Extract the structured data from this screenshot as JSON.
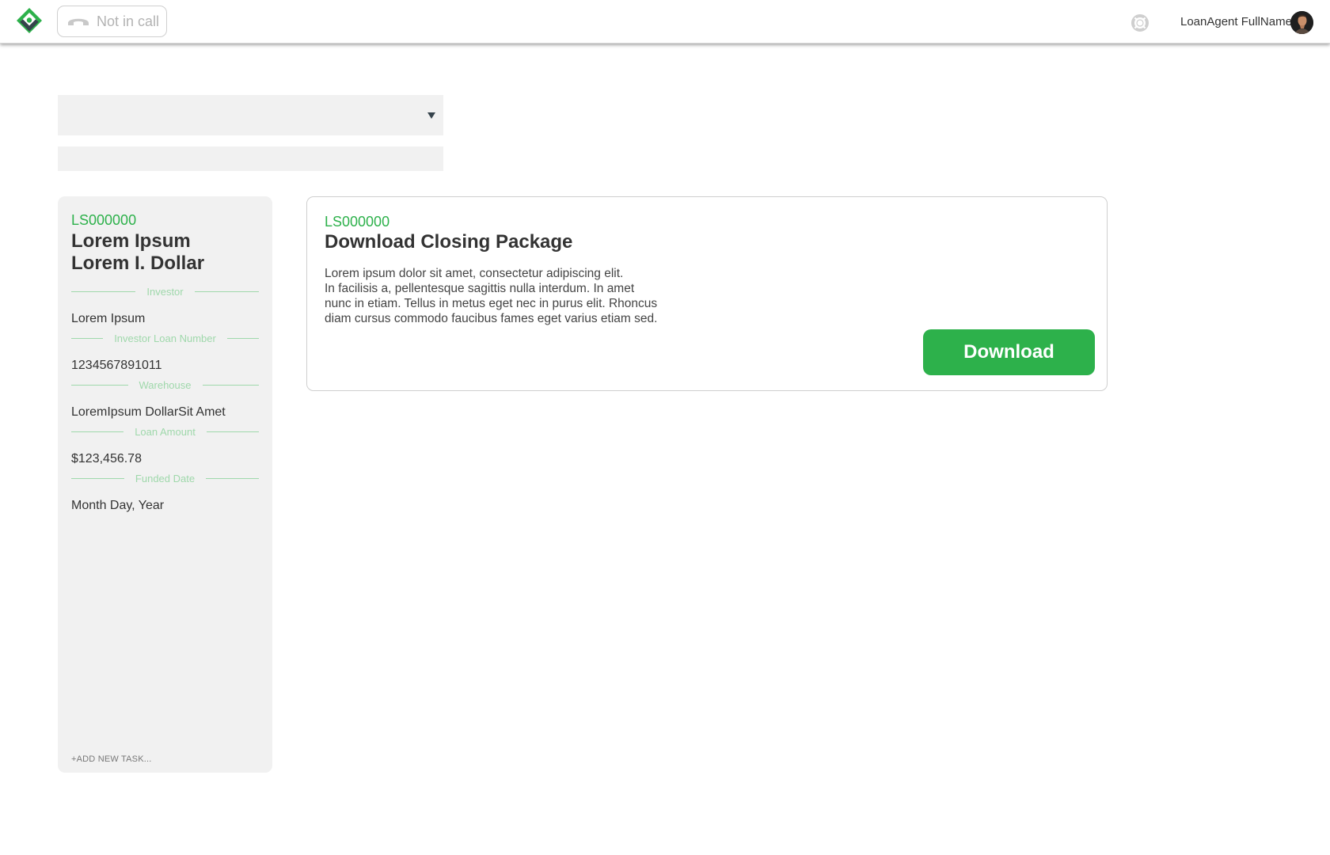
{
  "colors": {
    "accent": "#2db14b",
    "label_green": "#9fd8ab",
    "panel_bg": "#f1f1f1",
    "text": "#333333"
  },
  "header": {
    "logo_icon": "diamond-logo-icon",
    "call_status": {
      "icon": "phone-hangup-icon",
      "label": "Not in call"
    },
    "help_icon": "lifebuoy-icon",
    "user_name": "LoanAgent FullName",
    "avatar_icon": "user-avatar"
  },
  "filters": {
    "loan_select": {
      "selected": "",
      "caret_icon": "caret-down-icon"
    },
    "search": {
      "value": "",
      "placeholder": ""
    }
  },
  "loan_panel": {
    "loan_id": "LS000000",
    "borrower_line1": "Lorem Ipsum",
    "borrower_line2": "Lorem I. Dollar",
    "fields": [
      {
        "label": "Investor",
        "value": "Lorem Ipsum"
      },
      {
        "label": "Investor Loan Number",
        "value": "1234567891011"
      },
      {
        "label": "Warehouse",
        "value": "LoremIpsum DollarSit Amet"
      },
      {
        "label": "Loan Amount",
        "value": "$123,456.78"
      },
      {
        "label": "Funded Date",
        "value": "Month Day, Year"
      }
    ],
    "add_task_label": "+ADD NEW TASK..."
  },
  "task_card": {
    "loan_id": "LS000000",
    "title": "Download Closing Package",
    "description_lines": [
      "Lorem ipsum dolor sit amet, consectetur adipiscing elit.",
      "In facilisis a, pellentesque sagittis nulla interdum. In amet",
      "nunc in etiam. Tellus in metus eget nec in purus elit. Rhoncus",
      "diam cursus commodo faucibus fames eget varius etiam sed."
    ],
    "download_label": "Download"
  }
}
